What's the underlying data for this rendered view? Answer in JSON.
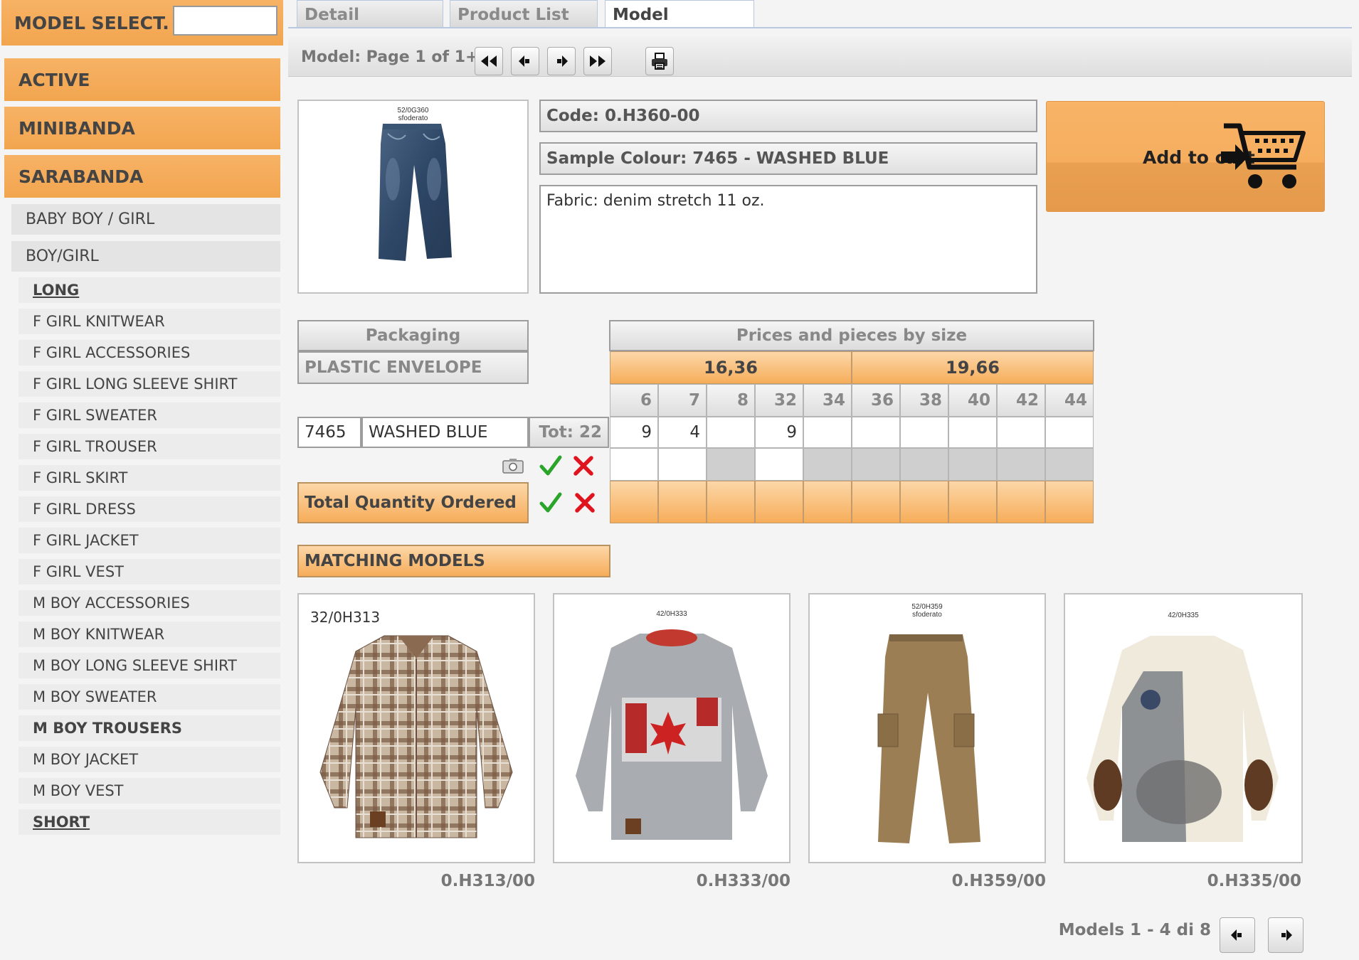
{
  "sidebar": {
    "title": "MODEL SELECT.",
    "search_value": "",
    "categories": [
      "ACTIVE",
      "MINIBANDA",
      "SARABANDA"
    ],
    "subcategories": [
      "BABY BOY / GIRL",
      "BOY/GIRL"
    ],
    "items": [
      "LONG",
      "F GIRL KNITWEAR",
      "F GIRL ACCESSORIES",
      "F GIRL LONG SLEEVE SHIRT",
      "F GIRL SWEATER",
      "F GIRL TROUSER",
      "F GIRL SKIRT",
      "F GIRL DRESS",
      "F GIRL JACKET",
      "F GIRL VEST",
      "M BOY ACCESSORIES",
      "M BOY KNITWEAR",
      "M BOY LONG SLEEVE SHIRT",
      "M BOY SWEATER",
      "M BOY TROUSERS",
      "M BOY JACKET",
      "M BOY VEST",
      "SHORT"
    ]
  },
  "tabs": [
    "Detail",
    "Product List",
    "Model"
  ],
  "toolbar": {
    "page_label": "Model: Page 1 of 1+"
  },
  "product": {
    "image_caption_1": "52/0G360",
    "image_caption_2": "sfoderato",
    "code": "Code: 0.H360-00",
    "sample_colour": "Sample Colour: 7465 - WASHED BLUE",
    "fabric": "Fabric: denim stretch 11 oz.",
    "cart_label": "Add to cart"
  },
  "packaging": {
    "header": "Packaging",
    "value": "PLASTIC ENVELOPE"
  },
  "grid": {
    "header": "Prices and pieces by size",
    "prices": [
      "16,36",
      "19,66"
    ],
    "sizes": [
      "6",
      "7",
      "8",
      "32",
      "34",
      "36",
      "38",
      "40",
      "42",
      "44"
    ],
    "row": {
      "color_code": "7465",
      "color_name": "WASHED BLUE",
      "total": "Tot: 22",
      "quantities": [
        "9",
        "4",
        "",
        "9",
        "",
        "",
        "",
        "",
        "",
        ""
      ]
    },
    "total_label": "Total Quantity Ordered"
  },
  "matching": {
    "header": "MATCHING MODELS",
    "items": [
      {
        "caption": "32/0H313",
        "caption2": "",
        "code": "0.H313/00"
      },
      {
        "caption": "42/0H333",
        "caption2": "",
        "code": "0.H333/00"
      },
      {
        "caption": "52/0H359",
        "caption2": "sfoderato",
        "code": "0.H359/00"
      },
      {
        "caption": "42/0H335",
        "caption2": "",
        "code": "0.H335/00"
      }
    ],
    "pager_label": "Models 1 - 4 di 8"
  },
  "colors": {
    "accent": "#f6ad5a",
    "check": "#2aa52a",
    "cross": "#e0141e"
  }
}
